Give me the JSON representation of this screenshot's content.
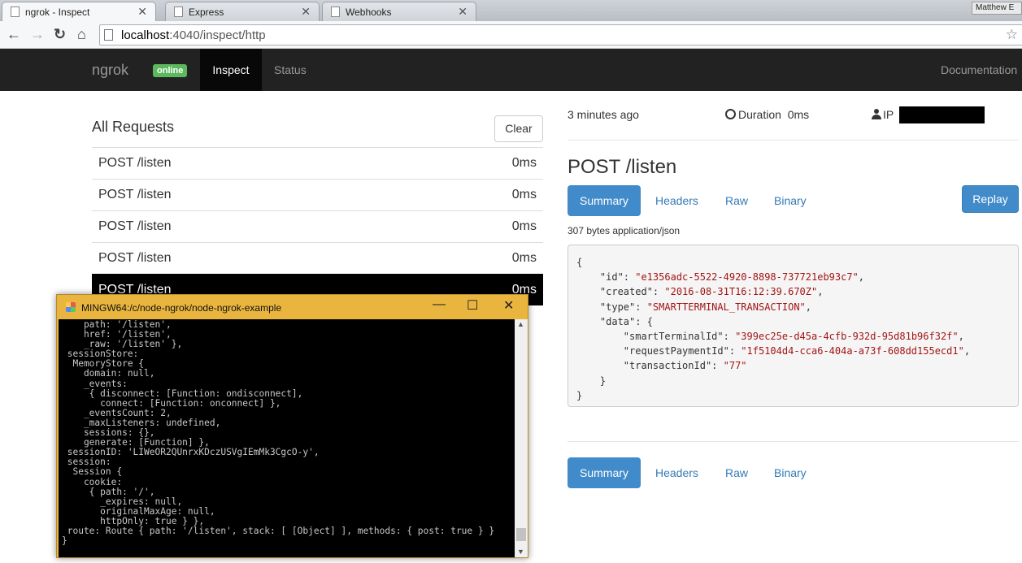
{
  "browser": {
    "tabs": [
      {
        "title": "ngrok - Inspect",
        "active": true
      },
      {
        "title": "Express",
        "active": false
      },
      {
        "title": "Webhooks",
        "active": false
      }
    ],
    "profile": "Matthew E",
    "url_host": "localhost",
    "url_path": ":4040/inspect/http"
  },
  "navbar": {
    "brand": "ngrok",
    "online_badge": "online",
    "inspect": "Inspect",
    "status": "Status",
    "documentation": "Documentation"
  },
  "requests": {
    "title": "All Requests",
    "clear_label": "Clear",
    "items": [
      {
        "method_path": "POST /listen",
        "duration": "0ms"
      },
      {
        "method_path": "POST /listen",
        "duration": "0ms"
      },
      {
        "method_path": "POST /listen",
        "duration": "0ms"
      },
      {
        "method_path": "POST /listen",
        "duration": "0ms"
      },
      {
        "method_path": "POST /listen",
        "duration": "0ms"
      }
    ]
  },
  "detail": {
    "ago": "3 minutes ago",
    "duration_label": "Duration",
    "duration_value": "0ms",
    "ip_label": "IP",
    "title": "POST /listen",
    "tabs": [
      "Summary",
      "Headers",
      "Raw",
      "Binary"
    ],
    "replay_label": "Replay",
    "meta": "307 bytes application/json",
    "json": {
      "id": "\"e1356adc-5522-4920-8898-737721eb93c7\"",
      "created": "\"2016-08-31T16:12:39.670Z\"",
      "type": "\"SMARTTERMINAL_TRANSACTION\"",
      "smartTerminalId": "\"399ec25e-d45a-4cfb-932d-95d81b96f32f\"",
      "requestPaymentId": "\"1f5104d4-cca6-404a-a73f-608dd155ecd1\"",
      "transactionId": "\"77\""
    },
    "response_tabs": [
      "Summary",
      "Headers",
      "Raw",
      "Binary"
    ]
  },
  "terminal": {
    "title": "MINGW64:/c/node-ngrok/node-ngrok-example",
    "lines": [
      "    path: '/listen',",
      "    href: '/listen',",
      "    _raw: '/listen' },",
      " sessionStore:",
      "  MemoryStore {",
      "    domain: null,",
      "    _events:",
      "     { disconnect: [Function: ondisconnect],",
      "       connect: [Function: onconnect] },",
      "    _eventsCount: 2,",
      "    _maxListeners: undefined,",
      "    sessions: {},",
      "    generate: [Function] },",
      " sessionID: 'LIWeOR2QUnrxKDczUSVgIEmMk3CgcO-y',",
      " session:",
      "  Session {",
      "    cookie:",
      "     { path: '/',",
      "       _expires: null,",
      "       originalMaxAge: null,",
      "       httpOnly: true } },",
      " route: Route { path: '/listen', stack: [ [Object] ], methods: { post: true } }",
      "}"
    ]
  }
}
